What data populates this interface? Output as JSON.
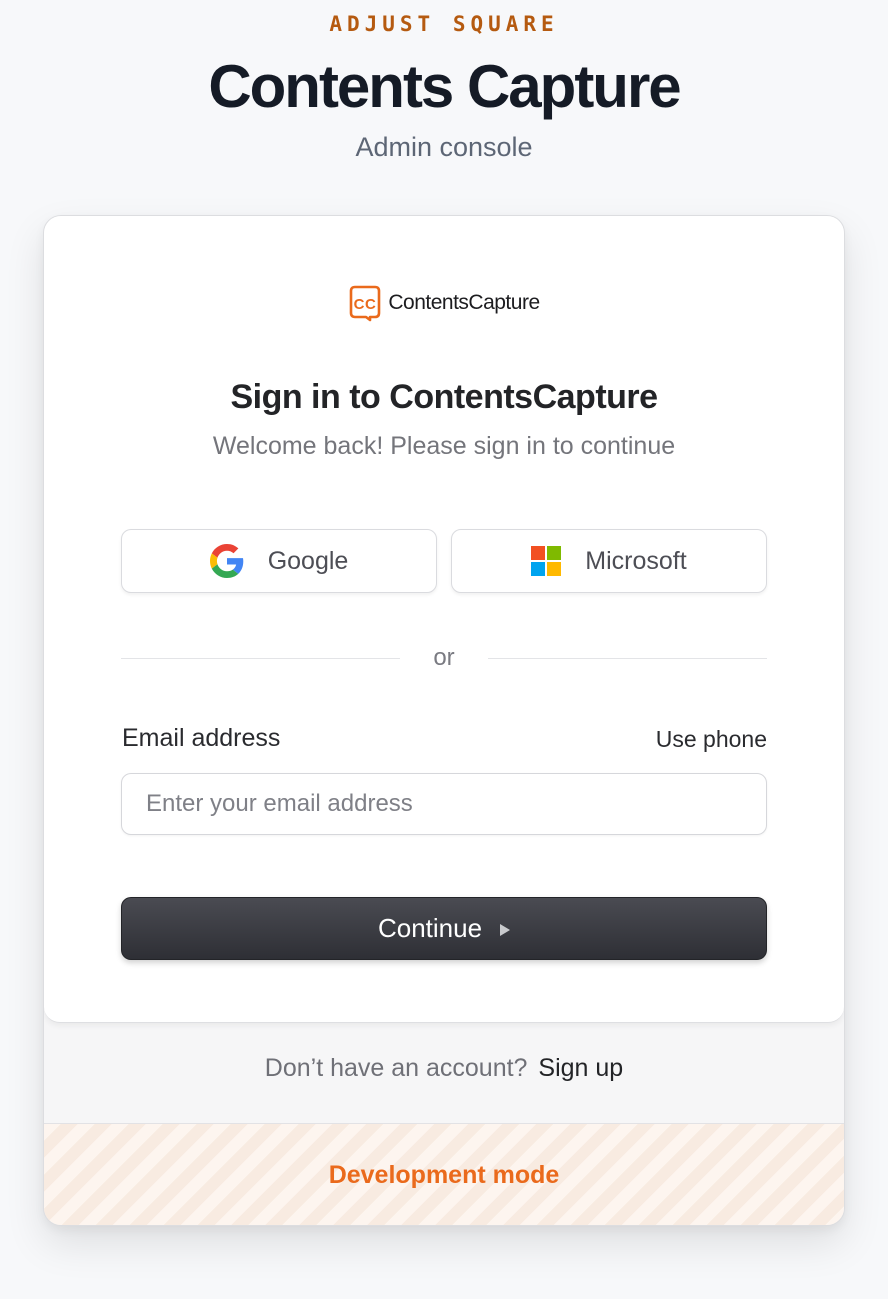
{
  "header": {
    "eyebrow": "ADJUST SQUARE",
    "title": "Contents Capture",
    "subtitle": "Admin console"
  },
  "card": {
    "logo_text": "ContentsCapture",
    "logo_mark_letters": "CC",
    "title": "Sign in to ContentsCapture",
    "subtitle": "Welcome back! Please sign in to continue",
    "social": {
      "google_label": "Google",
      "microsoft_label": "Microsoft"
    },
    "divider_text": "or",
    "email_label": "Email address",
    "use_phone_label": "Use phone",
    "email_value": "",
    "email_placeholder": "Enter your email address",
    "continue_label": "Continue"
  },
  "footer": {
    "prompt": "Don’t have an account?",
    "signup_label": "Sign up",
    "dev_mode_label": "Development mode"
  },
  "colors": {
    "accent_orange": "#ea6a1c",
    "eyebrow": "#b55a10",
    "button_dark": "#2e2f35"
  },
  "icons": [
    "google-icon",
    "microsoft-icon",
    "play-icon",
    "contentscapture-logo-icon"
  ]
}
